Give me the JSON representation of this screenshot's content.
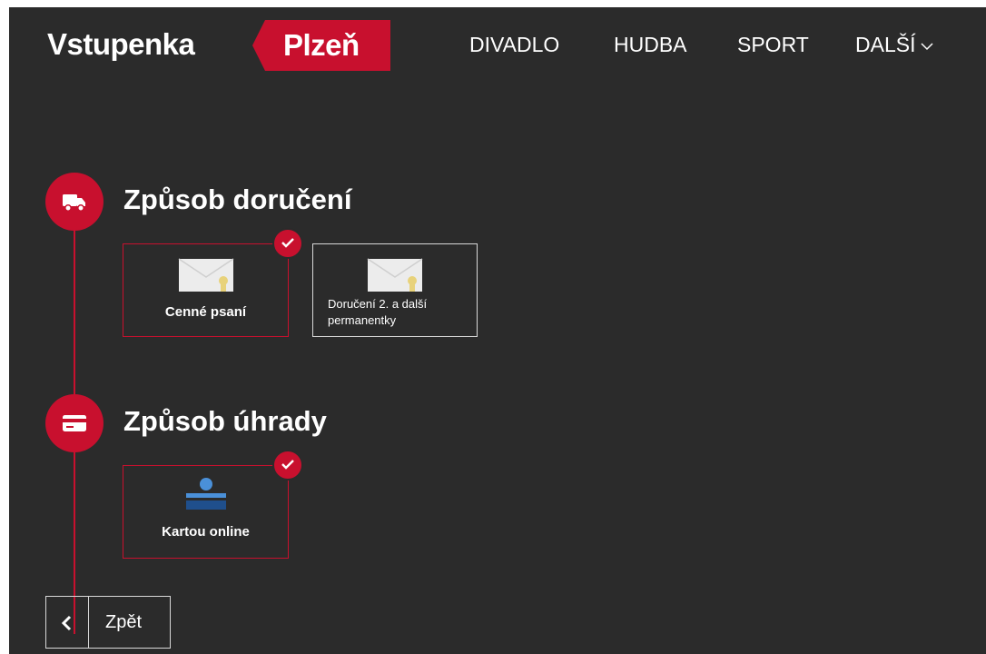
{
  "brand": {
    "name": "Vstupenka",
    "badge": "Plzeň",
    "badge_color": "#c8102e"
  },
  "nav": {
    "items": [
      "DIVADLO",
      "HUDBA",
      "SPORT"
    ],
    "more_label": "DALŠÍ"
  },
  "delivery": {
    "title": "Způsob doručení",
    "icon": "truck-icon",
    "options": [
      {
        "label": "Cenné psaní",
        "icon": "envelope-icon",
        "selected": true
      },
      {
        "label": "Doručení 2. a další permanentky",
        "icon": "envelope-icon",
        "selected": false
      }
    ]
  },
  "payment": {
    "title": "Způsob úhrady",
    "icon": "credit-card-icon",
    "options": [
      {
        "label": "Kartou online",
        "icon": "csob-logo",
        "selected": true
      }
    ]
  },
  "back_button": {
    "label": "Zpět",
    "icon": "chevron-left-icon"
  },
  "colors": {
    "background": "#2b2b2b",
    "accent": "#c8102e",
    "border": "#d8d8d8"
  }
}
